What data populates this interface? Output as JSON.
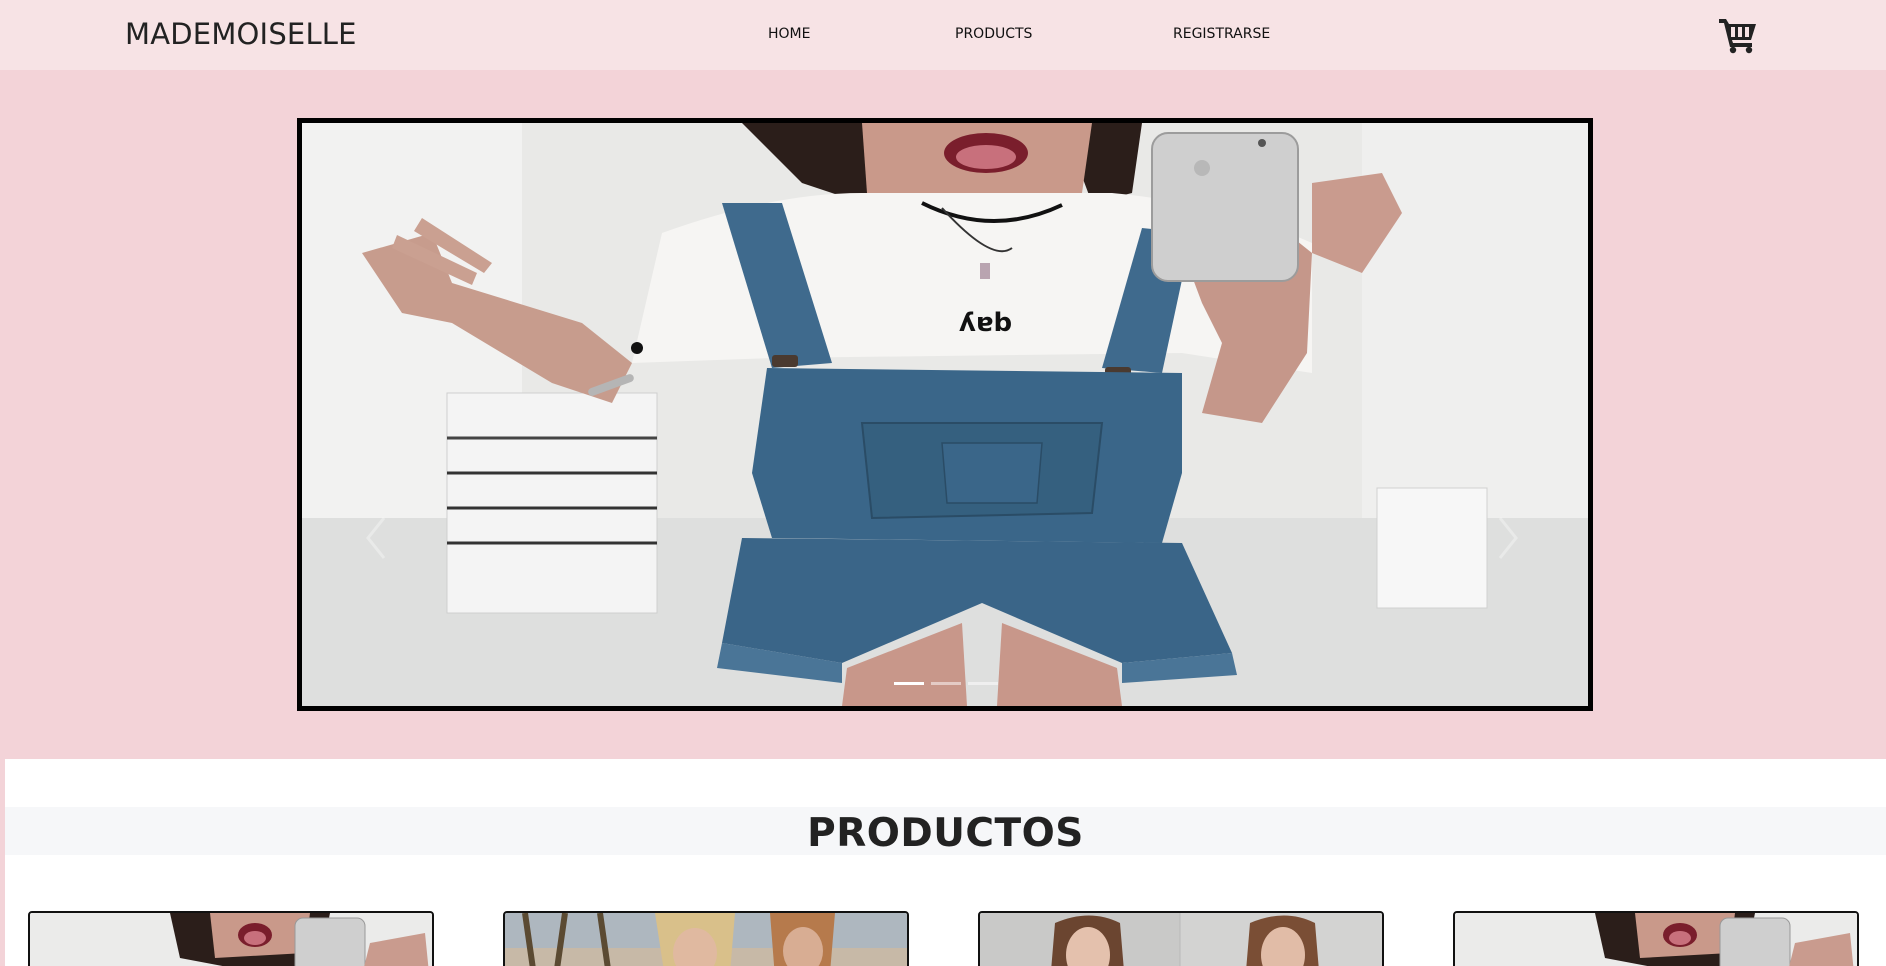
{
  "brand": "MADEMOISELLE",
  "nav": {
    "home": "HOME",
    "products": "PRODUCTS",
    "register": "REGISTRARSE"
  },
  "cart_icon": "shopping-cart-icon",
  "carousel": {
    "slide_image": "woman-denim-overalls-mirror-selfie",
    "shirt_print": "ʎɐb",
    "indicator_count": 3,
    "active_indicator": 1
  },
  "products": {
    "title": "PRODUCTOS",
    "cards": [
      {
        "image": "woman-denim-overalls-selfie"
      },
      {
        "image": "two-women-beach-palm-trees"
      },
      {
        "image": "two-women-studio-portrait"
      },
      {
        "image": "woman-denim-overalls-selfie"
      }
    ]
  },
  "colors": {
    "page_background": "#f3d3d8",
    "navbar_background": "#f7e3e5",
    "section_background": "#ffffff",
    "heading_band": "#f6f7f9"
  }
}
